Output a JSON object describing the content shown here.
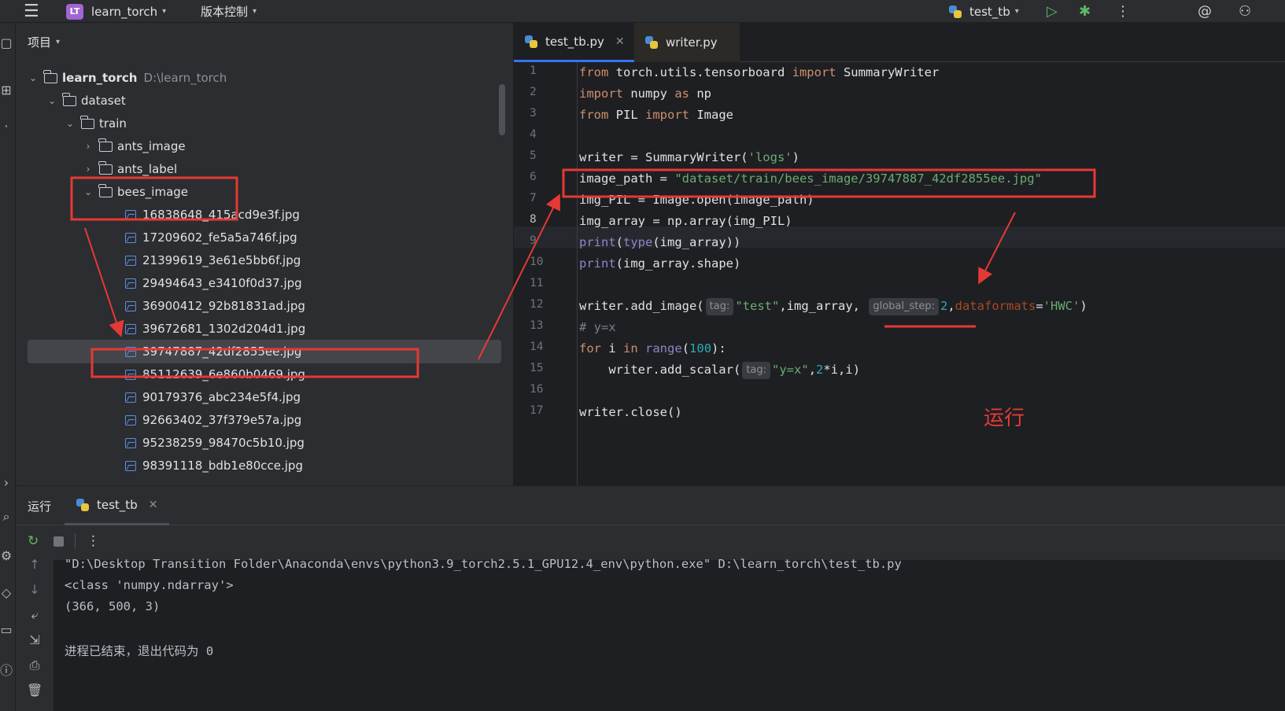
{
  "topbar": {
    "project_badge": "LT",
    "project_name": "learn_torch",
    "vcs_menu": "版本控制",
    "run_config": "test_tb"
  },
  "project_panel": {
    "title": "项目",
    "tree": [
      {
        "label": "learn_torch",
        "path": "D:\\learn_torch"
      },
      {
        "label": "dataset"
      },
      {
        "label": "train"
      },
      {
        "label": "ants_image"
      },
      {
        "label": "ants_label"
      },
      {
        "label": "bees_image"
      },
      {
        "label": "16838648_415acd9e3f.jpg"
      },
      {
        "label": "17209602_fe5a5a746f.jpg"
      },
      {
        "label": "21399619_3e61e5bb6f.jpg"
      },
      {
        "label": "29494643_e3410f0d37.jpg"
      },
      {
        "label": "36900412_92b81831ad.jpg"
      },
      {
        "label": "39672681_1302d204d1.jpg"
      },
      {
        "label": "39747887_42df2855ee.jpg"
      },
      {
        "label": "85112639_6e860b0469.jpg"
      },
      {
        "label": "90179376_abc234e5f4.jpg"
      },
      {
        "label": "92663402_37f379e57a.jpg"
      },
      {
        "label": "95238259_98470c5b10.jpg"
      },
      {
        "label": "98391118_bdb1e80cce.jpg"
      }
    ]
  },
  "editor": {
    "tabs": [
      {
        "label": "test_tb.py",
        "active": true
      },
      {
        "label": "writer.py",
        "active": false
      }
    ],
    "line_numbers": [
      "1",
      "2",
      "3",
      "4",
      "5",
      "6",
      "7",
      "8",
      "9",
      "10",
      "11",
      "12",
      "13",
      "14",
      "15",
      "16",
      "17"
    ],
    "code": {
      "l1": {
        "a": "from",
        "b": " torch.utils.tensorboard ",
        "c": "import",
        "d": " SummaryWriter"
      },
      "l2": {
        "a": "import",
        "b": " numpy ",
        "c": "as",
        "d": " np"
      },
      "l3": {
        "a": "from",
        "b": " PIL ",
        "c": "import",
        "d": " Image"
      },
      "l5": {
        "a": "writer = SummaryWriter(",
        "b": "'logs'",
        "c": ")"
      },
      "l6": {
        "a": "image_path = ",
        "b": "\"dataset/train/bees_image/39747887_42df2855ee.jpg\""
      },
      "l7": {
        "a": "img_PIL = Image.open(image_path)"
      },
      "l8": {
        "a": "img_array = np.array(img_PIL)"
      },
      "l9": {
        "a": "print",
        "b": "(",
        "c": "type",
        "d": "(img_array))"
      },
      "l10": {
        "a": "print",
        "b": "(img_array.shape)"
      },
      "l12": {
        "a": "writer.add_image(",
        "hint1": "tag:",
        "b": "\"test\"",
        "c": ",img_array, ",
        "hint2": "global_step:",
        "d": "2",
        "e": ",",
        "f": "dataformats",
        "g": "=",
        "h": "'HWC'",
        "i": ")"
      },
      "l13": {
        "a": "# y=x"
      },
      "l14": {
        "a": "for",
        "b": " i ",
        "c": "in",
        "d": " ",
        "e": "range",
        "f": "(",
        "g": "100",
        "h": "):"
      },
      "l15": {
        "a": "    writer.add_scalar(",
        "hint": "tag:",
        "b": "\"y=x\"",
        "c": ",",
        "d": "2",
        "e": "*i,i)"
      },
      "l17": {
        "a": "writer.close()"
      }
    },
    "annotation_run": "运行"
  },
  "run_panel": {
    "title": "运行",
    "tab_label": "test_tb",
    "console": [
      "\"D:\\Desktop Transition Folder\\Anaconda\\envs\\python3.9_torch2.5.1_GPU12.4_env\\python.exe\" D:\\learn_torch\\test_tb.py",
      "<class 'numpy.ndarray'>",
      "(366, 500, 3)",
      "",
      "进程已结束，退出代码为 0"
    ]
  },
  "colors": {
    "accent": "#3574f0",
    "annotation": "#e53935"
  }
}
